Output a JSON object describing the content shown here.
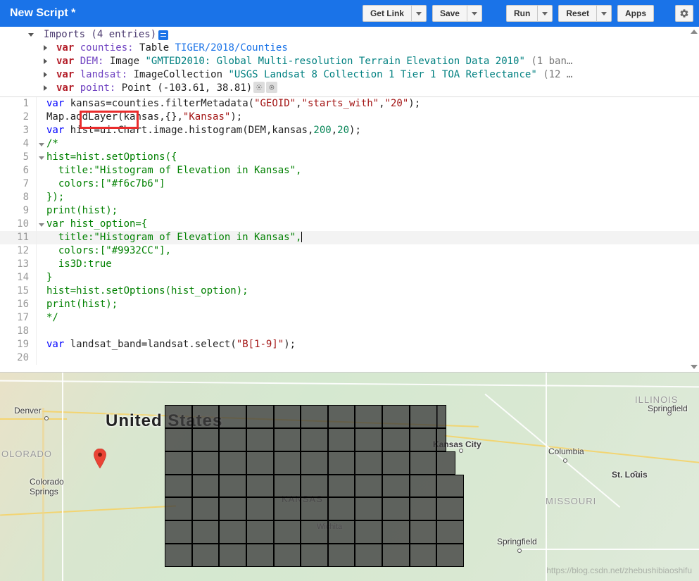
{
  "header": {
    "title": "New Script *",
    "buttons": {
      "getlink": "Get Link",
      "save": "Save",
      "run": "Run",
      "reset": "Reset",
      "apps": "Apps"
    }
  },
  "imports": {
    "header": "Imports (4 entries)",
    "entries": [
      {
        "var": "counties:",
        "type": "Table",
        "link": "TIGER/2018/Counties"
      },
      {
        "var": "DEM:",
        "type": "Image",
        "str": "\"GMTED2010: Global Multi-resolution Terrain Elevation Data 2010\"",
        "extra": "(1 ban…"
      },
      {
        "var": "landsat:",
        "type": "ImageCollection",
        "str": "\"USGS Landsat 8 Collection 1 Tier 1 TOA Reflectance\"",
        "extra": "(12 …"
      },
      {
        "var": "point:",
        "type": "Point",
        "coords": "(-103.61, 38.81)"
      }
    ]
  },
  "code": {
    "lines": [
      {
        "n": 1,
        "fold": "",
        "seg": [
          {
            "c": "c-kw",
            "t": "var"
          },
          {
            "c": "c-var",
            "t": " kansas"
          },
          {
            "c": "c-obj",
            "t": "="
          },
          {
            "c": "c-id",
            "t": "counties"
          },
          {
            "c": "c-obj",
            "t": "."
          },
          {
            "c": "c-method",
            "t": "filterMetadata"
          },
          {
            "c": "c-obj",
            "t": "("
          },
          {
            "c": "c-str",
            "t": "\"GEOID\""
          },
          {
            "c": "c-obj",
            "t": ","
          },
          {
            "c": "c-str",
            "t": "\"starts_with\""
          },
          {
            "c": "c-obj",
            "t": ","
          },
          {
            "c": "c-str",
            "t": "\"20\""
          },
          {
            "c": "c-obj",
            "t": ");"
          }
        ]
      },
      {
        "n": 2,
        "fold": "",
        "seg": [
          {
            "c": "c-id",
            "t": "Map"
          },
          {
            "c": "c-obj",
            "t": "."
          },
          {
            "c": "c-method",
            "t": "addLayer"
          },
          {
            "c": "c-obj",
            "t": "("
          },
          {
            "c": "c-id",
            "t": "kansas"
          },
          {
            "c": "c-obj",
            "t": ",{},"
          },
          {
            "c": "c-str",
            "t": "\"Kansas\""
          },
          {
            "c": "c-obj",
            "t": ");"
          }
        ]
      },
      {
        "n": 3,
        "fold": "",
        "seg": [
          {
            "c": "c-kw",
            "t": "var"
          },
          {
            "c": "c-var",
            "t": " hist"
          },
          {
            "c": "c-obj",
            "t": "="
          },
          {
            "c": "c-id",
            "t": "ui"
          },
          {
            "c": "c-obj",
            "t": "."
          },
          {
            "c": "c-id",
            "t": "Chart"
          },
          {
            "c": "c-obj",
            "t": "."
          },
          {
            "c": "c-id",
            "t": "image"
          },
          {
            "c": "c-obj",
            "t": "."
          },
          {
            "c": "c-method",
            "t": "histogram"
          },
          {
            "c": "c-obj",
            "t": "("
          },
          {
            "c": "c-id",
            "t": "DEM"
          },
          {
            "c": "c-obj",
            "t": ","
          },
          {
            "c": "c-id",
            "t": "kansas"
          },
          {
            "c": "c-obj",
            "t": ","
          },
          {
            "c": "c-num",
            "t": "200"
          },
          {
            "c": "c-obj",
            "t": ","
          },
          {
            "c": "c-num",
            "t": "20"
          },
          {
            "c": "c-obj",
            "t": ");"
          }
        ]
      },
      {
        "n": 4,
        "fold": "v",
        "seg": [
          {
            "c": "c-cmt",
            "t": "/*"
          }
        ]
      },
      {
        "n": 5,
        "fold": "v",
        "seg": [
          {
            "c": "c-cmt",
            "t": "hist=hist.setOptions({"
          }
        ]
      },
      {
        "n": 6,
        "fold": "",
        "seg": [
          {
            "c": "c-cmt",
            "t": "  title:\"Histogram of Elevation in Kansas\","
          }
        ]
      },
      {
        "n": 7,
        "fold": "",
        "seg": [
          {
            "c": "c-cmt",
            "t": "  colors:[\"#f6c7b6\"]"
          }
        ]
      },
      {
        "n": 8,
        "fold": "",
        "seg": [
          {
            "c": "c-cmt",
            "t": "});"
          }
        ]
      },
      {
        "n": 9,
        "fold": "",
        "seg": [
          {
            "c": "c-cmt",
            "t": "print(hist);"
          }
        ]
      },
      {
        "n": 10,
        "fold": "v",
        "seg": [
          {
            "c": "c-cmt",
            "t": "var hist_option={"
          }
        ]
      },
      {
        "n": 11,
        "fold": "",
        "active": true,
        "seg": [
          {
            "c": "c-cmt",
            "t": "  title:\"Histogram of Elevation in Kansas\","
          }
        ]
      },
      {
        "n": 12,
        "fold": "",
        "seg": [
          {
            "c": "c-cmt",
            "t": "  colors:[\"#9932CC\"],"
          }
        ]
      },
      {
        "n": 13,
        "fold": "",
        "seg": [
          {
            "c": "c-cmt",
            "t": "  is3D:true"
          }
        ]
      },
      {
        "n": 14,
        "fold": "",
        "seg": [
          {
            "c": "c-cmt",
            "t": "}"
          }
        ]
      },
      {
        "n": 15,
        "fold": "",
        "seg": [
          {
            "c": "c-cmt",
            "t": "hist=hist.setOptions(hist_option);"
          }
        ]
      },
      {
        "n": 16,
        "fold": "",
        "seg": [
          {
            "c": "c-cmt",
            "t": "print(hist);"
          }
        ]
      },
      {
        "n": 17,
        "fold": "",
        "seg": [
          {
            "c": "c-cmt",
            "t": "*/"
          }
        ]
      },
      {
        "n": 18,
        "fold": "",
        "seg": [
          {
            "c": "c-var",
            "t": ""
          }
        ]
      },
      {
        "n": 19,
        "fold": "",
        "seg": [
          {
            "c": "c-kw",
            "t": "var"
          },
          {
            "c": "c-var",
            "t": " landsat_band"
          },
          {
            "c": "c-obj",
            "t": "="
          },
          {
            "c": "c-id",
            "t": "landsat"
          },
          {
            "c": "c-obj",
            "t": "."
          },
          {
            "c": "c-method",
            "t": "select"
          },
          {
            "c": "c-obj",
            "t": "("
          },
          {
            "c": "c-str",
            "t": "\"B[1-9]\""
          },
          {
            "c": "c-obj",
            "t": ");"
          }
        ]
      },
      {
        "n": 20,
        "fold": "",
        "seg": [
          {
            "c": "c-var",
            "t": ""
          }
        ]
      }
    ]
  },
  "map": {
    "big_label": "United States",
    "states": {
      "colorado": "OLORADO",
      "illinois": "ILLINOIS",
      "missouri": "MISSOURI",
      "kansas": "KANSAS"
    },
    "cities": {
      "denver": "Denver",
      "csprings": "Colorado\nSprings",
      "kc": "Kansas City",
      "columbia": "Columbia",
      "stlouis": "St. Louis",
      "springfield_mo": "Springfield",
      "springfield_il": "Springfield",
      "wichita": "Wichita"
    },
    "watermark": "https://blog.csdn.net/zhebushibiaoshifu"
  }
}
